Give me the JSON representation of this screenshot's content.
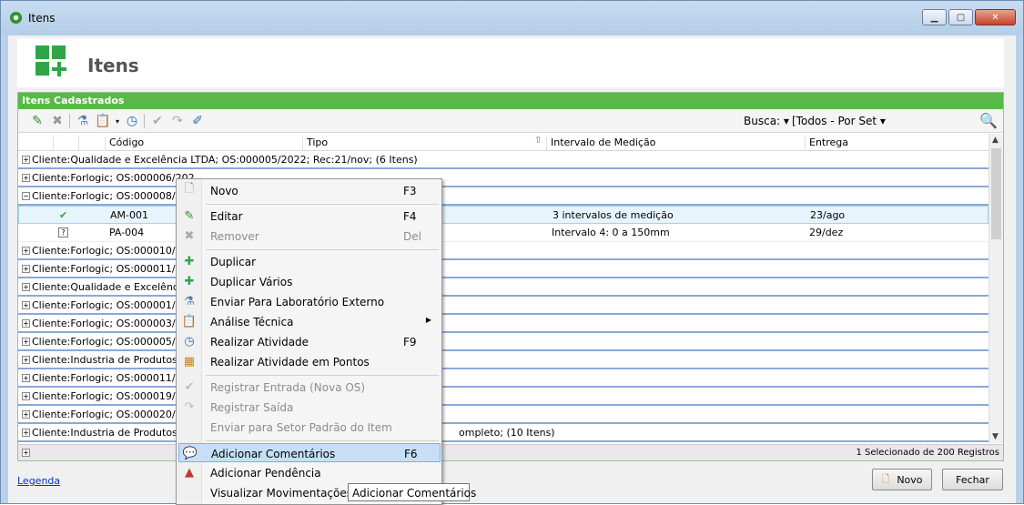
{
  "window": {
    "title": "Itens"
  },
  "header": {
    "title": "Itens"
  },
  "panel": {
    "title": "Itens Cadastrados"
  },
  "toolbar": {
    "busca_label": "Busca:",
    "busca_value": "[Todos - Por Set",
    "icons": [
      "edit-icon",
      "remove-icon",
      "lab-icon",
      "clipboard-icon",
      "clock-icon",
      "checkmark-icon",
      "forward-icon",
      "tag-icon"
    ]
  },
  "columns": [
    "Código",
    "Tipo",
    "Intervalo de Medição",
    "Entrega"
  ],
  "rows": [
    {
      "type": "group",
      "text": "Cliente:Qualidade e Excelência LTDA;    OS:000005/2022;    Rec:21/nov;    (6 Itens)",
      "expanded": false
    },
    {
      "type": "group",
      "text": "Cliente:Forlogic;    OS:000006/202",
      "expanded": false
    },
    {
      "type": "group",
      "text": "Cliente:Forlogic;    OS:000008/202",
      "expanded": true
    },
    {
      "type": "item",
      "codigo": "AM-001",
      "intervalo": "3 intervalos de medição",
      "entrega": "23/ago",
      "status": "ok",
      "selected": true
    },
    {
      "type": "item",
      "codigo": "PA-004",
      "intervalo": "Intervalo 4: 0 a 150mm",
      "entrega": "29/dez",
      "status": "unknown",
      "selected": false
    },
    {
      "type": "group",
      "text": "Cliente:Forlogic;    OS:000010/202",
      "expanded": false
    },
    {
      "type": "group",
      "text": "Cliente:Forlogic;    OS:000011/202",
      "expanded": false
    },
    {
      "type": "group",
      "text": "Cliente:Qualidade e Excelência LT",
      "expanded": false
    },
    {
      "type": "group",
      "text": "Cliente:Forlogic;    OS:000001/202",
      "expanded": false
    },
    {
      "type": "group",
      "text": "Cliente:Forlogic;    OS:000003/202",
      "expanded": false
    },
    {
      "type": "group",
      "text": "Cliente:Forlogic;    OS:000005/202",
      "expanded": false
    },
    {
      "type": "group",
      "text": "Cliente:Industria de Produtos Agric",
      "expanded": false
    },
    {
      "type": "group",
      "text": "Cliente:Forlogic;    OS:000011/202",
      "expanded": false
    },
    {
      "type": "group",
      "text": "Cliente:Forlogic;    OS:000019/202",
      "expanded": false
    },
    {
      "type": "group",
      "text": "Cliente:Forlogic;    OS:000020/202",
      "expanded": false
    },
    {
      "type": "group",
      "text": "Cliente:Industria de Produtos Agric",
      "tail": "ompleto;    (10 Itens)",
      "expanded": false
    }
  ],
  "status": "1 Selecionado de 200 Registros",
  "footer": {
    "legend": "Legenda",
    "novo": "Novo",
    "fechar": "Fechar"
  },
  "context_menu": [
    {
      "label": "Novo",
      "shortcut": "F3",
      "icon": "new-icon",
      "disabled": false
    },
    {
      "sep": true
    },
    {
      "label": "Editar",
      "shortcut": "F4",
      "icon": "edit-icon",
      "disabled": false
    },
    {
      "label": "Remover",
      "shortcut": "Del",
      "icon": "remove-icon",
      "disabled": true
    },
    {
      "sep": true
    },
    {
      "label": "Duplicar",
      "shortcut": "",
      "icon": "plus-icon",
      "disabled": false
    },
    {
      "label": "Duplicar Vários",
      "shortcut": "",
      "icon": "plus-icon",
      "disabled": false
    },
    {
      "label": "Enviar Para Laboratório Externo",
      "shortcut": "",
      "icon": "lab-icon",
      "disabled": false
    },
    {
      "label": "Análise Técnica",
      "shortcut": "",
      "icon": "clipboard-icon",
      "disabled": false,
      "submenu": true
    },
    {
      "label": "Realizar Atividade",
      "shortcut": "F9",
      "icon": "clock-icon",
      "disabled": false
    },
    {
      "label": "Realizar Atividade em Pontos",
      "shortcut": "",
      "icon": "points-icon",
      "disabled": false
    },
    {
      "sep": true
    },
    {
      "label": "Registrar Entrada (Nova OS)",
      "shortcut": "",
      "icon": "checkmark-icon",
      "disabled": true
    },
    {
      "label": "Registrar Saída",
      "shortcut": "",
      "icon": "forward-icon",
      "disabled": true
    },
    {
      "label": "Enviar para Setor Padrão do Item",
      "shortcut": "",
      "icon": "",
      "disabled": true
    },
    {
      "sep": true
    },
    {
      "label": "Adicionar Comentários",
      "shortcut": "F6",
      "icon": "comment-icon",
      "disabled": false,
      "hover": true
    },
    {
      "label": "Adicionar Pendência",
      "shortcut": "",
      "icon": "warning-icon",
      "disabled": false
    },
    {
      "label": "Visualizar Movimentações e",
      "shortcut": "",
      "icon": "",
      "disabled": false
    }
  ],
  "tooltip": "Adicionar Comentários",
  "colors": {
    "accent_green": "#5ab848",
    "selection": "#c6dff7",
    "group_line": "#8aa8d8"
  }
}
